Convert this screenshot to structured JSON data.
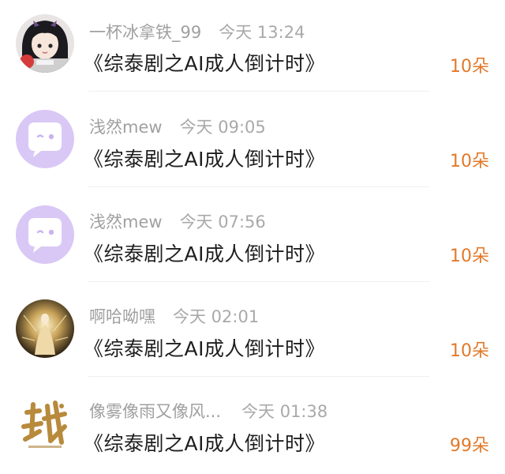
{
  "items": [
    {
      "name": "一杯冰拿铁_99",
      "time": "今天 13:24",
      "title": "《综泰剧之AI成人倒计时》",
      "gift": "10朵",
      "avatar": "anime-girl-avatar"
    },
    {
      "name": "浅然mew",
      "time": "今天 09:05",
      "title": "《综泰剧之AI成人倒计时》",
      "gift": "10朵",
      "avatar": "default-chat-avatar"
    },
    {
      "name": "浅然mew",
      "time": "今天 07:56",
      "title": "《综泰剧之AI成人倒计时》",
      "gift": "10朵",
      "avatar": "default-chat-avatar"
    },
    {
      "name": "啊哈呦嘿",
      "time": "今天 02:01",
      "title": "《综泰剧之AI成人倒计时》",
      "gift": "10朵",
      "avatar": "golden-figure-avatar"
    },
    {
      "name": "像雾像雨又像风...",
      "time": "今天 01:38",
      "title": "《综泰剧之AI成人倒计时》",
      "gift": "99朵",
      "avatar": "zhan-calligraphy-avatar"
    }
  ],
  "colors": {
    "gift": "#e2792a",
    "meta": "#a3a3a3",
    "title": "#1e1e1e",
    "default_avatar_bg": "#d9c8f5"
  }
}
